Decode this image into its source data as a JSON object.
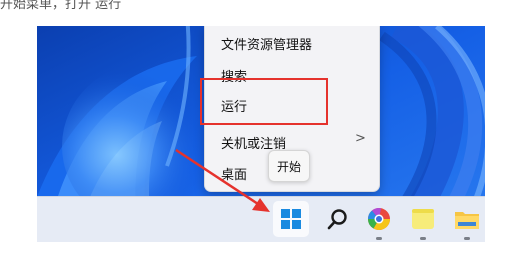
{
  "caption": "开始菜单，打开 运行",
  "context_menu": {
    "items": [
      {
        "label": "文件资源管理器"
      },
      {
        "label": "搜索"
      },
      {
        "label": "运行"
      },
      {
        "label": "关机或注销"
      },
      {
        "label": "桌面"
      }
    ],
    "submenu_arrow": ">"
  },
  "tooltip": {
    "text": "开始"
  },
  "taskbar": {
    "icons": [
      "windows-start-icon",
      "search-icon",
      "chrome-like-browser-icon",
      "notes-icon",
      "file-explorer-folder-icon"
    ]
  },
  "colors": {
    "highlight": "#e5322d",
    "arrow": "#e5322d",
    "wallpaper_base": "#0d4fcf"
  }
}
